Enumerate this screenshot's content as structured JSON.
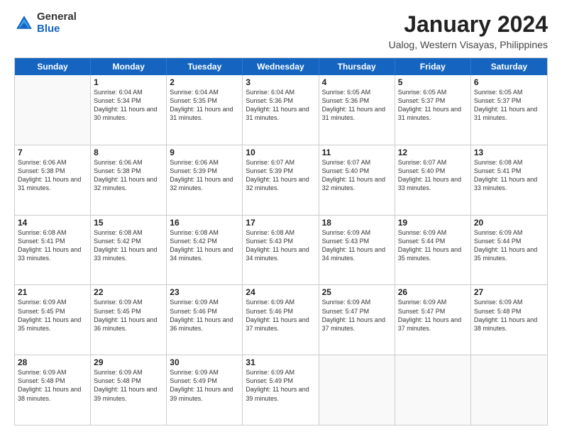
{
  "logo": {
    "general": "General",
    "blue": "Blue"
  },
  "title": "January 2024",
  "subtitle": "Ualog, Western Visayas, Philippines",
  "days": [
    "Sunday",
    "Monday",
    "Tuesday",
    "Wednesday",
    "Thursday",
    "Friday",
    "Saturday"
  ],
  "weeks": [
    [
      {
        "day": "",
        "sunrise": "",
        "sunset": "",
        "daylight": ""
      },
      {
        "day": "1",
        "sunrise": "Sunrise: 6:04 AM",
        "sunset": "Sunset: 5:34 PM",
        "daylight": "Daylight: 11 hours and 30 minutes."
      },
      {
        "day": "2",
        "sunrise": "Sunrise: 6:04 AM",
        "sunset": "Sunset: 5:35 PM",
        "daylight": "Daylight: 11 hours and 31 minutes."
      },
      {
        "day": "3",
        "sunrise": "Sunrise: 6:04 AM",
        "sunset": "Sunset: 5:36 PM",
        "daylight": "Daylight: 11 hours and 31 minutes."
      },
      {
        "day": "4",
        "sunrise": "Sunrise: 6:05 AM",
        "sunset": "Sunset: 5:36 PM",
        "daylight": "Daylight: 11 hours and 31 minutes."
      },
      {
        "day": "5",
        "sunrise": "Sunrise: 6:05 AM",
        "sunset": "Sunset: 5:37 PM",
        "daylight": "Daylight: 11 hours and 31 minutes."
      },
      {
        "day": "6",
        "sunrise": "Sunrise: 6:05 AM",
        "sunset": "Sunset: 5:37 PM",
        "daylight": "Daylight: 11 hours and 31 minutes."
      }
    ],
    [
      {
        "day": "7",
        "sunrise": "Sunrise: 6:06 AM",
        "sunset": "Sunset: 5:38 PM",
        "daylight": "Daylight: 11 hours and 31 minutes."
      },
      {
        "day": "8",
        "sunrise": "Sunrise: 6:06 AM",
        "sunset": "Sunset: 5:38 PM",
        "daylight": "Daylight: 11 hours and 32 minutes."
      },
      {
        "day": "9",
        "sunrise": "Sunrise: 6:06 AM",
        "sunset": "Sunset: 5:39 PM",
        "daylight": "Daylight: 11 hours and 32 minutes."
      },
      {
        "day": "10",
        "sunrise": "Sunrise: 6:07 AM",
        "sunset": "Sunset: 5:39 PM",
        "daylight": "Daylight: 11 hours and 32 minutes."
      },
      {
        "day": "11",
        "sunrise": "Sunrise: 6:07 AM",
        "sunset": "Sunset: 5:40 PM",
        "daylight": "Daylight: 11 hours and 32 minutes."
      },
      {
        "day": "12",
        "sunrise": "Sunrise: 6:07 AM",
        "sunset": "Sunset: 5:40 PM",
        "daylight": "Daylight: 11 hours and 33 minutes."
      },
      {
        "day": "13",
        "sunrise": "Sunrise: 6:08 AM",
        "sunset": "Sunset: 5:41 PM",
        "daylight": "Daylight: 11 hours and 33 minutes."
      }
    ],
    [
      {
        "day": "14",
        "sunrise": "Sunrise: 6:08 AM",
        "sunset": "Sunset: 5:41 PM",
        "daylight": "Daylight: 11 hours and 33 minutes."
      },
      {
        "day": "15",
        "sunrise": "Sunrise: 6:08 AM",
        "sunset": "Sunset: 5:42 PM",
        "daylight": "Daylight: 11 hours and 33 minutes."
      },
      {
        "day": "16",
        "sunrise": "Sunrise: 6:08 AM",
        "sunset": "Sunset: 5:42 PM",
        "daylight": "Daylight: 11 hours and 34 minutes."
      },
      {
        "day": "17",
        "sunrise": "Sunrise: 6:08 AM",
        "sunset": "Sunset: 5:43 PM",
        "daylight": "Daylight: 11 hours and 34 minutes."
      },
      {
        "day": "18",
        "sunrise": "Sunrise: 6:09 AM",
        "sunset": "Sunset: 5:43 PM",
        "daylight": "Daylight: 11 hours and 34 minutes."
      },
      {
        "day": "19",
        "sunrise": "Sunrise: 6:09 AM",
        "sunset": "Sunset: 5:44 PM",
        "daylight": "Daylight: 11 hours and 35 minutes."
      },
      {
        "day": "20",
        "sunrise": "Sunrise: 6:09 AM",
        "sunset": "Sunset: 5:44 PM",
        "daylight": "Daylight: 11 hours and 35 minutes."
      }
    ],
    [
      {
        "day": "21",
        "sunrise": "Sunrise: 6:09 AM",
        "sunset": "Sunset: 5:45 PM",
        "daylight": "Daylight: 11 hours and 35 minutes."
      },
      {
        "day": "22",
        "sunrise": "Sunrise: 6:09 AM",
        "sunset": "Sunset: 5:45 PM",
        "daylight": "Daylight: 11 hours and 36 minutes."
      },
      {
        "day": "23",
        "sunrise": "Sunrise: 6:09 AM",
        "sunset": "Sunset: 5:46 PM",
        "daylight": "Daylight: 11 hours and 36 minutes."
      },
      {
        "day": "24",
        "sunrise": "Sunrise: 6:09 AM",
        "sunset": "Sunset: 5:46 PM",
        "daylight": "Daylight: 11 hours and 37 minutes."
      },
      {
        "day": "25",
        "sunrise": "Sunrise: 6:09 AM",
        "sunset": "Sunset: 5:47 PM",
        "daylight": "Daylight: 11 hours and 37 minutes."
      },
      {
        "day": "26",
        "sunrise": "Sunrise: 6:09 AM",
        "sunset": "Sunset: 5:47 PM",
        "daylight": "Daylight: 11 hours and 37 minutes."
      },
      {
        "day": "27",
        "sunrise": "Sunrise: 6:09 AM",
        "sunset": "Sunset: 5:48 PM",
        "daylight": "Daylight: 11 hours and 38 minutes."
      }
    ],
    [
      {
        "day": "28",
        "sunrise": "Sunrise: 6:09 AM",
        "sunset": "Sunset: 5:48 PM",
        "daylight": "Daylight: 11 hours and 38 minutes."
      },
      {
        "day": "29",
        "sunrise": "Sunrise: 6:09 AM",
        "sunset": "Sunset: 5:48 PM",
        "daylight": "Daylight: 11 hours and 39 minutes."
      },
      {
        "day": "30",
        "sunrise": "Sunrise: 6:09 AM",
        "sunset": "Sunset: 5:49 PM",
        "daylight": "Daylight: 11 hours and 39 minutes."
      },
      {
        "day": "31",
        "sunrise": "Sunrise: 6:09 AM",
        "sunset": "Sunset: 5:49 PM",
        "daylight": "Daylight: 11 hours and 39 minutes."
      },
      {
        "day": "",
        "sunrise": "",
        "sunset": "",
        "daylight": ""
      },
      {
        "day": "",
        "sunrise": "",
        "sunset": "",
        "daylight": ""
      },
      {
        "day": "",
        "sunrise": "",
        "sunset": "",
        "daylight": ""
      }
    ]
  ]
}
